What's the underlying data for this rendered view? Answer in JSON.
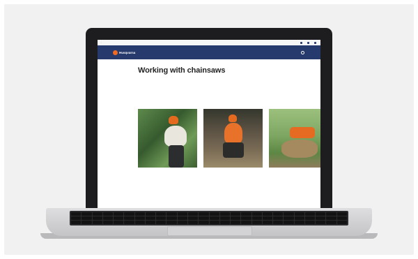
{
  "site": {
    "utility": {
      "language": "",
      "links": [
        {
          "icon": "store-icon",
          "label": ""
        },
        {
          "icon": "account-icon",
          "label": ""
        },
        {
          "icon": "cart-icon",
          "label": ""
        }
      ]
    },
    "logo": "Husqvarna",
    "nav": {
      "items": [
        "",
        "",
        "",
        "",
        "",
        ""
      ],
      "search_label": ""
    },
    "breadcrumb": [
      "",
      "",
      ""
    ],
    "page_title": "Working with chainsaws",
    "byline": "",
    "share": "",
    "cards": [
      {
        "kicker": "",
        "title": "",
        "text": "",
        "link": ""
      },
      {
        "kicker": "",
        "title": "",
        "text": "",
        "link": ""
      },
      {
        "kicker": "",
        "title": "",
        "text": "",
        "link": ""
      }
    ]
  },
  "colors": {
    "brand_nav": "#273a6e",
    "brand_orange": "#f26a21",
    "laptop_bezel": "#1d1d1f"
  }
}
